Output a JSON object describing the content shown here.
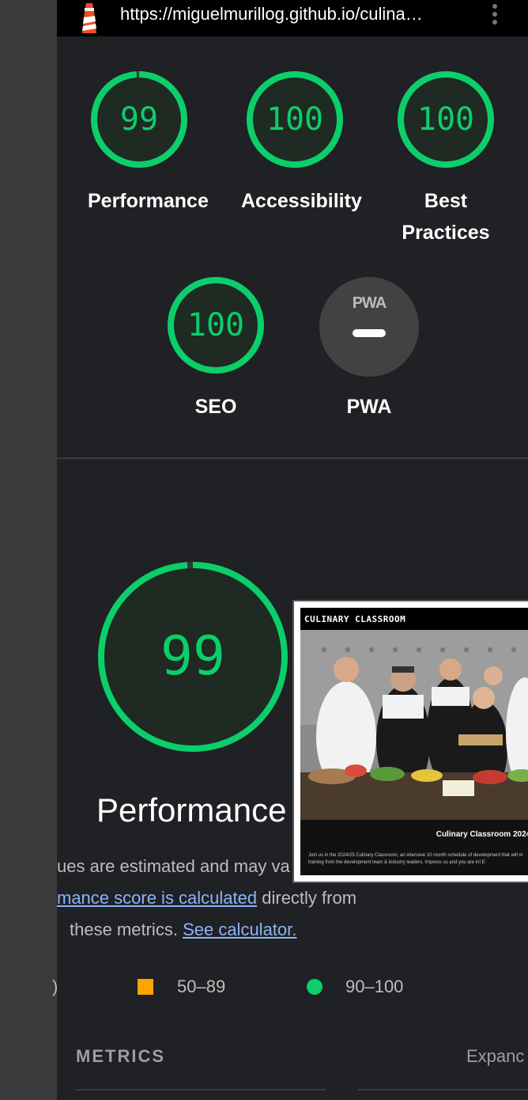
{
  "browser": {
    "url": "https://miguelmurillog.github.io/culina…",
    "logo_icon": "lighthouse-icon",
    "menu_icon": "kebab-menu-icon"
  },
  "colors": {
    "pass": "#0cce6b",
    "average": "#ffa400",
    "link": "#8ab4f8"
  },
  "categories": [
    {
      "score": "99",
      "label": "Performance",
      "progress": 0.99
    },
    {
      "score": "100",
      "label": "Accessibility",
      "progress": 1.0
    },
    {
      "score": "100",
      "label_line1": "Best",
      "label_line2": "Practices",
      "progress": 1.0
    },
    {
      "score": "100",
      "label": "SEO",
      "progress": 1.0
    },
    {
      "badge": "PWA",
      "label": "PWA"
    }
  ],
  "performance": {
    "score": "99",
    "progress": 0.99,
    "label": "Performance",
    "desc_line1": "ues are estimated and may va",
    "desc_line2_link": "mance score is calculated",
    "desc_line2_rest": "directly from",
    "desc_line3": "these metrics.",
    "desc_line3_link": "See calculator."
  },
  "screenshot": {
    "title": "CULINARY CLASSROOM",
    "caption_title": "Culinary Classroom 2024/",
    "caption_body_1": "Join us in the 2024/25 Culinary Classroom, an intensive 10 month schedule of development that will m",
    "caption_body_2": "training from the development team & industry leaders. Impress us and you are in! E"
  },
  "legend": {
    "left_fragment": ")",
    "average": "50–89",
    "pass": "90–100"
  },
  "metrics": {
    "title": "METRICS",
    "expand": "Expanc"
  }
}
